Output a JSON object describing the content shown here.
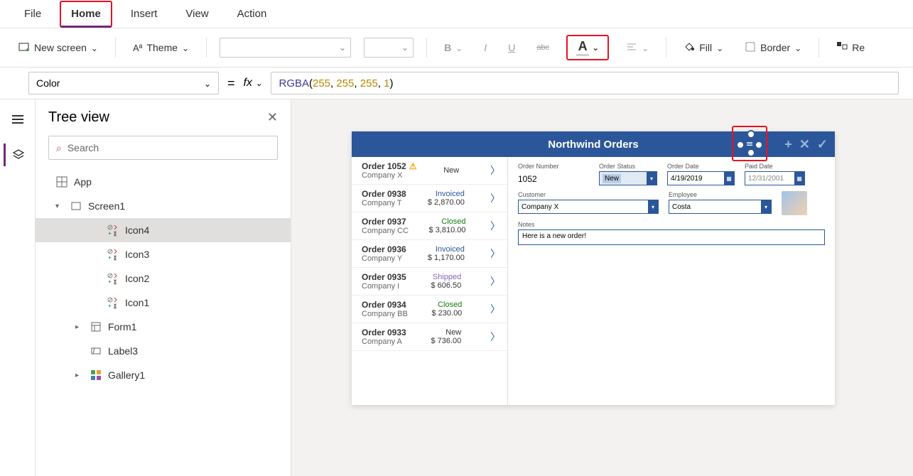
{
  "menu": {
    "file": "File",
    "home": "Home",
    "insert": "Insert",
    "view": "View",
    "action": "Action"
  },
  "ribbon": {
    "new_screen": "New screen",
    "theme": "Theme",
    "fill": "Fill",
    "border": "Border",
    "reorder": "Re"
  },
  "formula": {
    "property": "Color",
    "fx": "fx",
    "equals": "=",
    "func": "RGBA",
    "args": [
      "255",
      "255",
      "255",
      "1"
    ]
  },
  "tree": {
    "title": "Tree view",
    "search_placeholder": "Search",
    "app": "App",
    "screen": "Screen1",
    "items": [
      {
        "label": "Icon4",
        "selected": true
      },
      {
        "label": "Icon3",
        "selected": false
      },
      {
        "label": "Icon2",
        "selected": false
      },
      {
        "label": "Icon1",
        "selected": false
      },
      {
        "label": "Form1",
        "selected": false,
        "expandable": true,
        "icon": "form"
      },
      {
        "label": "Label3",
        "selected": false,
        "icon": "label"
      },
      {
        "label": "Gallery1",
        "selected": false,
        "expandable": true,
        "icon": "gallery"
      }
    ]
  },
  "app": {
    "title": "Northwind Orders",
    "orders": [
      {
        "title": "Order 1052",
        "company": "Company X",
        "status": "New",
        "status_class": "st-new",
        "amount": "",
        "warn": true
      },
      {
        "title": "Order 0938",
        "company": "Company T",
        "status": "Invoiced",
        "status_class": "st-invoiced",
        "amount": "$ 2,870.00"
      },
      {
        "title": "Order 0937",
        "company": "Company CC",
        "status": "Closed",
        "status_class": "st-closed",
        "amount": "$ 3,810.00"
      },
      {
        "title": "Order 0936",
        "company": "Company Y",
        "status": "Invoiced",
        "status_class": "st-invoiced",
        "amount": "$ 1,170.00"
      },
      {
        "title": "Order 0935",
        "company": "Company I",
        "status": "Shipped",
        "status_class": "st-shipped",
        "amount": "$ 606.50"
      },
      {
        "title": "Order 0934",
        "company": "Company BB",
        "status": "Closed",
        "status_class": "st-closed",
        "amount": "$ 230.00"
      },
      {
        "title": "Order 0933",
        "company": "Company A",
        "status": "New",
        "status_class": "st-new",
        "amount": "$ 736.00"
      }
    ],
    "detail": {
      "order_number_label": "Order Number",
      "order_number": "1052",
      "order_status_label": "Order Status",
      "order_status": "New",
      "order_date_label": "Order Date",
      "order_date": "4/19/2019",
      "paid_date_label": "Paid Date",
      "paid_date": "12/31/2001",
      "customer_label": "Customer",
      "customer": "Company X",
      "employee_label": "Employee",
      "employee": "Costa",
      "notes_label": "Notes",
      "notes": "Here is a new order!"
    }
  }
}
